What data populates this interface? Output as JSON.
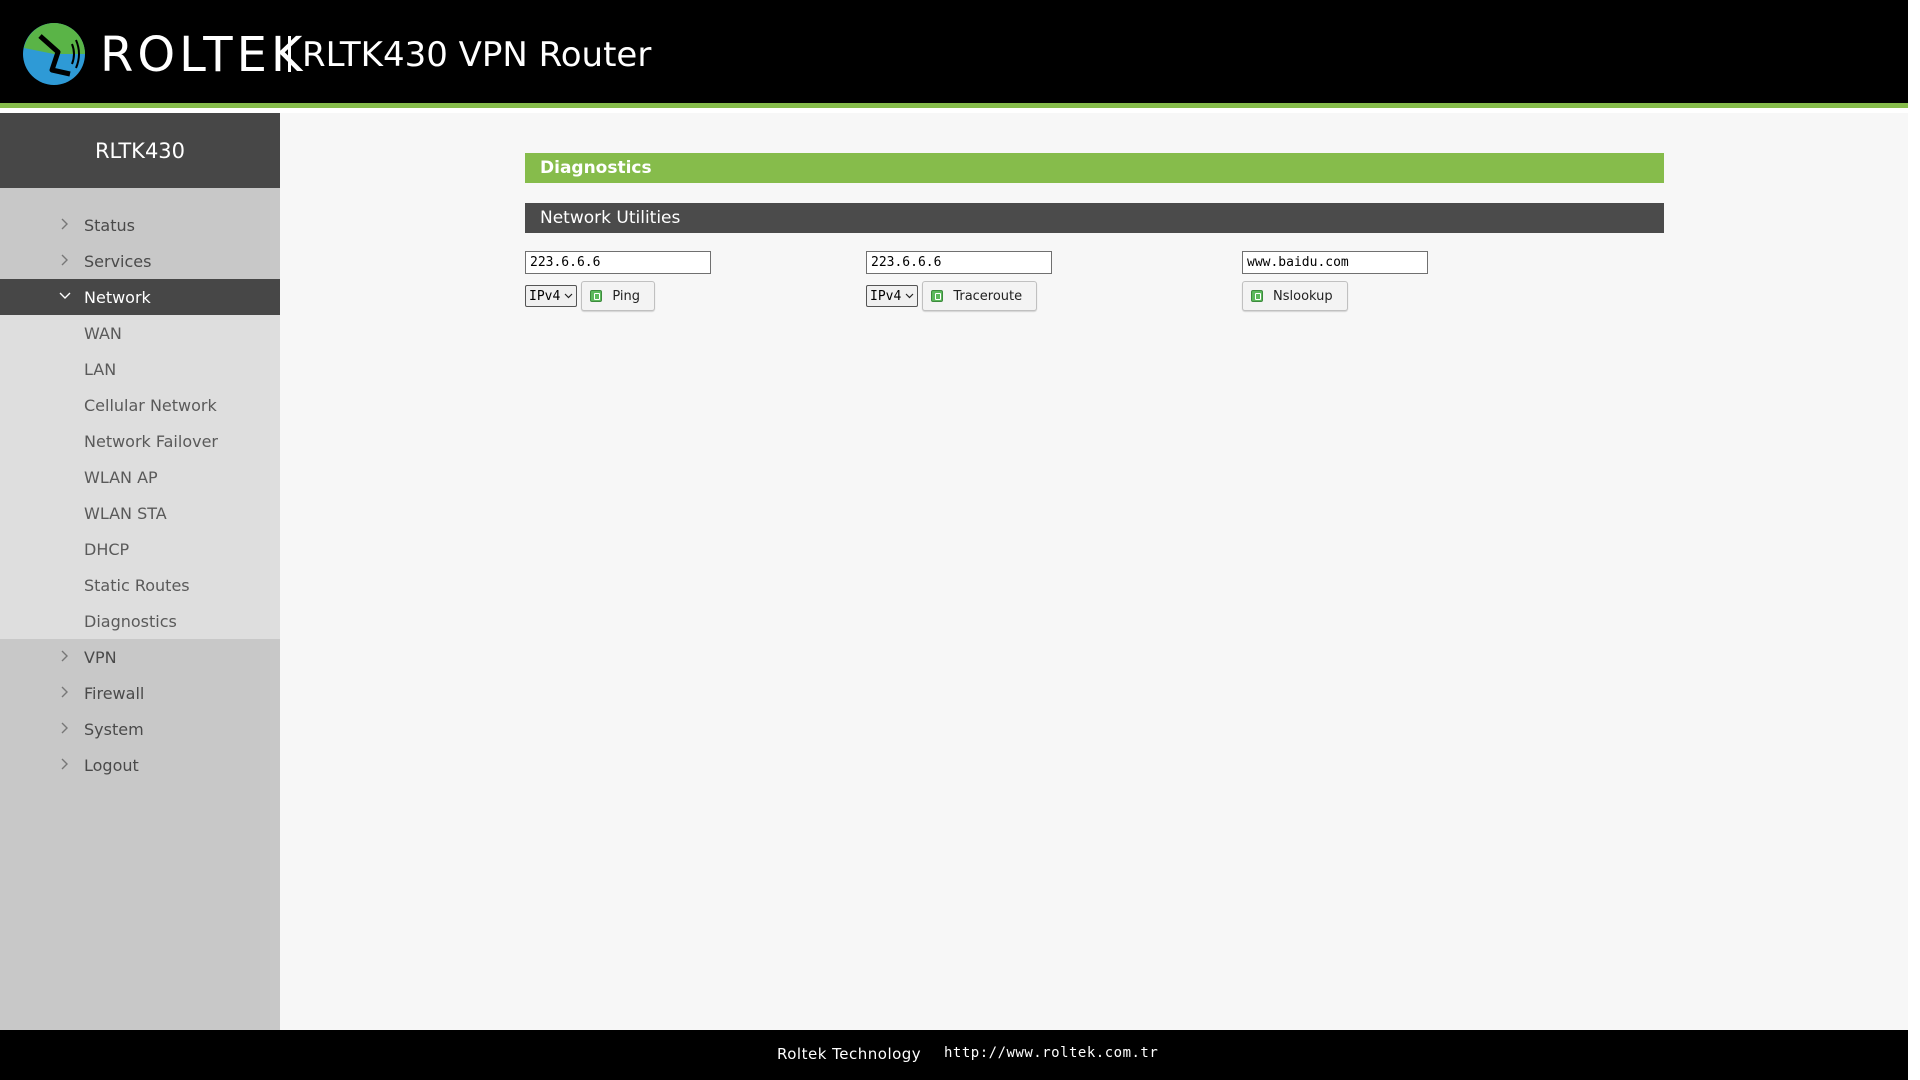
{
  "header": {
    "brand": "ROLTEK",
    "product": "RLTK430 VPN Router",
    "colors": {
      "bar": "#000000",
      "accent": "#86bc4b",
      "logo_green": "#5ab447",
      "logo_blue": "#2e9ad6"
    }
  },
  "sidebar": {
    "device": "RLTK430",
    "menu": [
      {
        "label": "Status",
        "icon": "chevron-right-icon"
      },
      {
        "label": "Services",
        "icon": "chevron-right-icon"
      },
      {
        "label": "Network",
        "icon": "chevron-down-icon",
        "expanded": true
      },
      {
        "label": "VPN",
        "icon": "chevron-right-icon"
      },
      {
        "label": "Firewall",
        "icon": "chevron-right-icon"
      },
      {
        "label": "System",
        "icon": "chevron-right-icon"
      },
      {
        "label": "Logout",
        "icon": "chevron-right-icon"
      }
    ],
    "network_submenu": [
      "WAN",
      "LAN",
      "Cellular Network",
      "Network Failover",
      "WLAN AP",
      "WLAN STA",
      "DHCP",
      "Static Routes",
      "Diagnostics"
    ]
  },
  "main": {
    "page_title": "Diagnostics",
    "section_title": "Network Utilities",
    "ping": {
      "value": "223.6.6.6",
      "protocol": "IPv4",
      "button": "Ping"
    },
    "traceroute": {
      "value": "223.6.6.6",
      "protocol": "IPv4",
      "button": "Traceroute"
    },
    "nslookup": {
      "value": "www.baidu.com",
      "button": "Nslookup"
    }
  },
  "footer": {
    "company": "Roltek Technology",
    "url": "http://www.roltek.com.tr"
  }
}
